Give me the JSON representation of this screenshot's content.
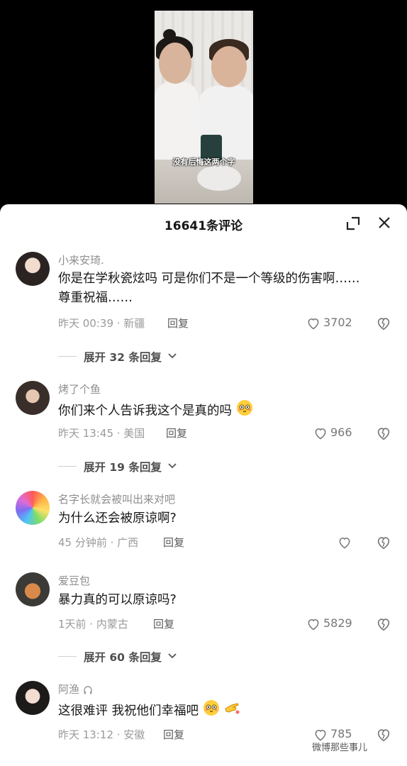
{
  "video": {
    "subtitle": "没有后悔这两个字"
  },
  "header": {
    "title": "16641条评论"
  },
  "comments": [
    {
      "username": "小来安琦.",
      "text": "你是在学秋瓷炫吗 可是你们不是一个等级的伤害啊……尊重祝福……",
      "meta": "昨天 00:39 · 新疆",
      "reply": "回复",
      "likes": "3702",
      "expand": "展开 32 条回复"
    },
    {
      "username": "烤了个鱼",
      "text": "你们来个人告诉我这个是真的吗",
      "meta": "昨天 13:45 · 美国",
      "reply": "回复",
      "likes": "966",
      "expand": "展开 19 条回复"
    },
    {
      "username": "名字长就会被叫出来对吧",
      "text": "为什么还会被原谅啊?",
      "meta": "45 分钟前 · 广西",
      "reply": "回复",
      "likes": ""
    },
    {
      "username": "爱豆包",
      "text": "暴力真的可以原谅吗?",
      "meta": "1天前 · 内蒙古",
      "reply": "回复",
      "likes": "5829",
      "expand": "展开 60 条回复"
    },
    {
      "username": "阿渔",
      "text": "这很难评 我祝他们幸福吧",
      "meta": "昨天 13:12 · 安徽",
      "reply": "回复",
      "likes": "785"
    }
  ],
  "watermark": {
    "text": "微博那些事儿"
  },
  "icons": {
    "expand": "expand-icon",
    "close": "close-icon",
    "heart": "heart-icon",
    "dislike": "broken-heart-icon",
    "chevron": "chevron-down-icon",
    "emoji_flushed": "flushed-face-emoji",
    "emoji_hand": "pointing-hand-emoji",
    "headphones": "headphones-icon"
  },
  "colors": {
    "sheet_bg": "#ffffff",
    "text": "#161616",
    "meta": "#9a9a9a",
    "username": "#8e8e8e"
  }
}
